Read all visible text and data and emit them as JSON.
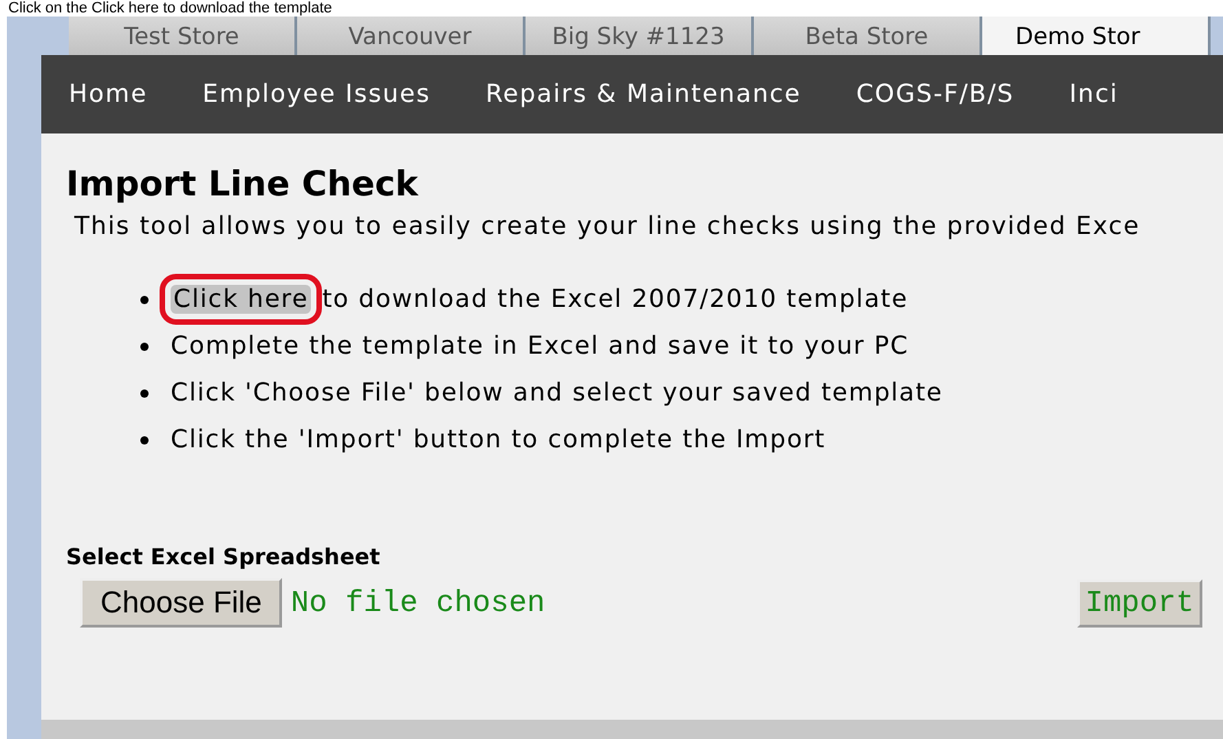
{
  "caption": "Click on the Click here to download the template",
  "store_tabs": [
    {
      "label": "Test Store",
      "selected": false
    },
    {
      "label": "Vancouver",
      "selected": false
    },
    {
      "label": "Big Sky #1123",
      "selected": false
    },
    {
      "label": "Beta Store",
      "selected": false
    },
    {
      "label": "Demo Stor",
      "selected": true
    }
  ],
  "nav": [
    "Home",
    "Employee Issues",
    "Repairs & Maintenance",
    "COGS-F/B/S",
    "Inci"
  ],
  "page": {
    "title": "Import Line Check",
    "intro": "This tool allows you to easily create your line checks using the provided Exce",
    "steps": [
      {
        "link": "Click here",
        "link_circled": true,
        "text": "to download the Excel 2007/2010 template"
      },
      {
        "text": "Complete the template in Excel and save it to your PC"
      },
      {
        "text": "Click 'Choose File' below and select your saved template"
      },
      {
        "text": "Click the 'Import' button to complete the Import"
      }
    ],
    "upload_label": "Select Excel Spreadsheet",
    "choose_button": "Choose File",
    "file_status": "No file chosen",
    "import_button": "Import"
  }
}
